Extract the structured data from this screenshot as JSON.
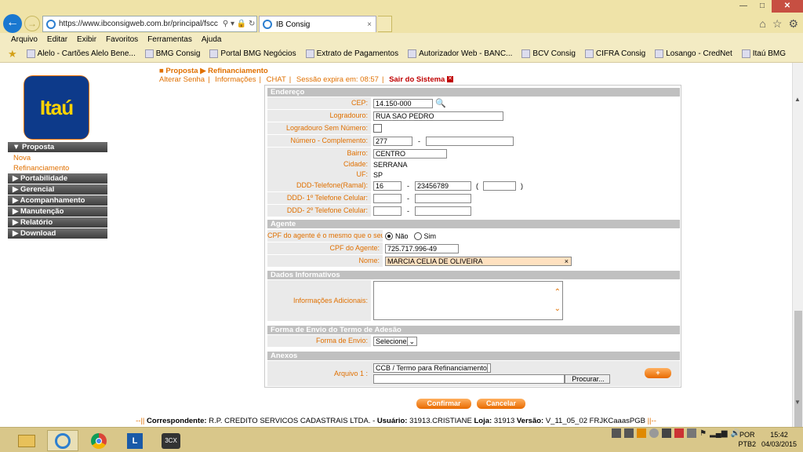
{
  "browser": {
    "url": "https://www.ibconsigweb.com.br/principal/fscc",
    "tab_title": "IB Consig",
    "tab_close": "×",
    "menu": [
      "Arquivo",
      "Editar",
      "Exibir",
      "Favoritos",
      "Ferramentas",
      "Ajuda"
    ],
    "favorites": [
      "Alelo - Cartões Alelo Bene...",
      "BMG Consig",
      "Portal BMG Negócios",
      "Extrato de Pagamentos",
      "Autorizador Web - BANC...",
      "BCV Consig",
      "CIFRA Consig",
      "Losango - CredNet",
      "Itaú BMG"
    ],
    "window_controls": {
      "minimize": "—",
      "maximize": "□",
      "close": "✕"
    }
  },
  "logo": {
    "text": "Itaú"
  },
  "nav": {
    "proposta": "▼ Proposta",
    "nova": "Nova",
    "refinanciamento": "Refinanciamento",
    "portabilidade": "▶ Portabilidade",
    "gerencial": "▶ Gerencial",
    "acompanhamento": "▶ Acompanhamento",
    "manutencao": "▶ Manutenção",
    "relatorio": "▶ Relatório",
    "download": "▶ Download"
  },
  "breadcrumb": {
    "proposta": "Proposta",
    "refinanciamento": "Refinanciamento"
  },
  "toplinks": {
    "alterar_senha": "Alterar Senha",
    "informacoes": "Informações",
    "chat": "CHAT",
    "sessao": "Sessão expira em: 08:57",
    "sair": "Sair do Sistema"
  },
  "endereco": {
    "title": "Endereço",
    "cep_label": "CEP:",
    "cep": "14.150-000",
    "logradouro_label": "Logradouro:",
    "logradouro": "RUA SAO PEDRO",
    "sem_numero_label": "Logradouro Sem Número:",
    "numero_label": "Número - Complemento:",
    "numero": "277",
    "dash": "-",
    "bairro_label": "Bairro:",
    "bairro": "CENTRO",
    "cidade_label": "Cidade:",
    "cidade": "SERRANA",
    "uf_label": "UF:",
    "uf": "SP",
    "ddd_tel_label": "DDD-Telefone(Ramal):",
    "ddd": "16",
    "telefone": "23456789",
    "paren_open": "(",
    "paren_close": ")",
    "cel1_label": "DDD- 1º Telefone Celular:",
    "cel2_label": "DDD- 2º Telefone Celular:"
  },
  "agente": {
    "title": "Agente",
    "cpf_mesmo_label": "CPF do agente é o mesmo que o seu?",
    "nao": "Não",
    "sim": "Sim",
    "cpf_label": "CPF do Agente:",
    "cpf": "725.717.996-49",
    "nome_label": "Nome:",
    "nome": "MARCIA CELIA DE OLIVEIRA",
    "nome_clear": "×"
  },
  "dados": {
    "title": "Dados Informativos",
    "info_label": "Informações Adicionais:"
  },
  "envio": {
    "title": "Forma de Envio do Termo de Adesão",
    "label": "Forma de Envio:",
    "value": "Selecione"
  },
  "anexos": {
    "title": "Anexos",
    "arquivo_label": "Arquivo 1 :",
    "tipo": "CCB / Termo para Refinanciamento",
    "procurar": "Procurar...",
    "add": "+"
  },
  "actions": {
    "confirmar": "Confirmar",
    "cancelar": "Cancelar"
  },
  "status": {
    "prefix": "--||",
    "correspondente_label": "Correspondente:",
    "correspondente": "R.P. CREDITO SERVICOS CADASTRAIS LTDA. -",
    "usuario_label": "Usuário:",
    "usuario": "31913.CRISTIANE",
    "loja_label": "Loja:",
    "loja": "31913",
    "versao_label": "Versão:",
    "versao": "V_11_05_02  FRJKCaaasPGB",
    "suffix": "||--"
  },
  "taskbar": {
    "lang": "POR",
    "layout": "PTB2",
    "time": "15:42",
    "date": "04/03/2015",
    "app_3cx": "3CX"
  }
}
